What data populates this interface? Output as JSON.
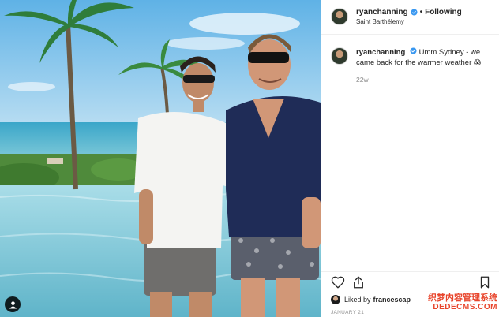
{
  "post": {
    "username": "ryanchanning",
    "separator": "•",
    "follow_label": "Following",
    "location": "Saint Barthélemy"
  },
  "caption": {
    "username": "ryanchanning",
    "text": "Umm Sydney - we came back for the warmer weather",
    "emoji": "😱",
    "time_ago": "22w"
  },
  "likes": {
    "prefix": "Liked by",
    "name": "francescap"
  },
  "date": "JANUARY 21",
  "watermark": {
    "cn": "织梦内容管理系统",
    "en": "DEDECMS.COM"
  },
  "icons": {
    "verified": "verified-badge-icon",
    "heart": "heart-icon",
    "share": "share-icon",
    "bookmark": "bookmark-icon",
    "user_tag": "user-tag-icon"
  },
  "colors": {
    "verified_blue": "#3897f0",
    "muted_text": "#8e8e8e",
    "border": "#efefef",
    "watermark_red": "#e8452c"
  }
}
